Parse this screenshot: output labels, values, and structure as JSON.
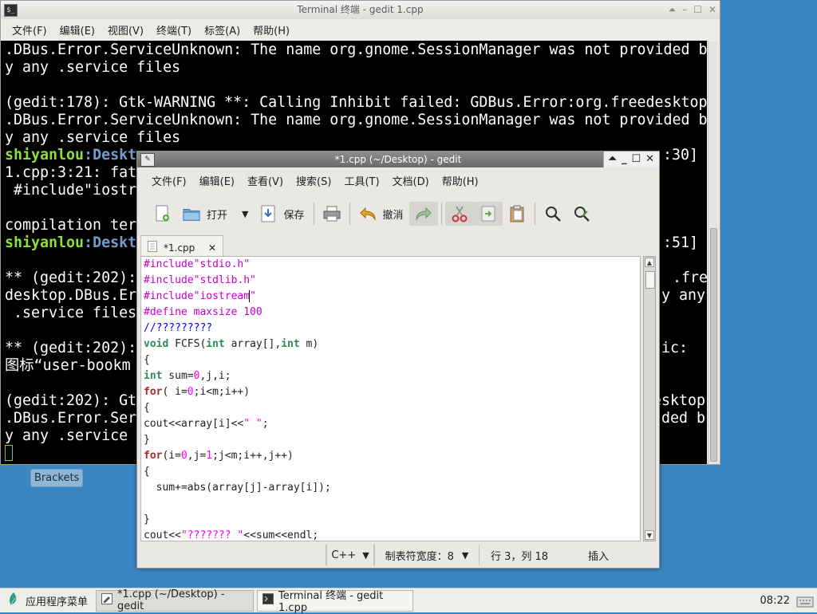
{
  "desktop": {
    "brackets_label": "Brackets"
  },
  "terminal": {
    "title": "Terminal 终端 - gedit 1.cpp",
    "menu": [
      "文件(F)",
      "编辑(E)",
      "视图(V)",
      "终端(T)",
      "标签(A)",
      "帮助(H)"
    ],
    "lines": [
      ".DBus.Error.ServiceUnknown: The name org.gnome.SessionManager was not provided b",
      "y any .service files",
      "",
      "(gedit:178): Gtk-WARNING **: Calling Inhibit failed: GDBus.Error:org.freedesktop",
      ".DBus.Error.ServiceUnknown: The name org.gnome.SessionManager was not provided b",
      "y any .service files",
      {
        "prompt_user": "shiyanlou",
        "prompt_path": ":Deskt",
        "tail": ":30]"
      },
      "1.cpp:3:21: fat",
      " #include\"iostr",
      "",
      "compilation ter",
      {
        "prompt_user": "shiyanlou",
        "prompt_path": ":Deskt",
        "tail": ":51]"
      },
      "",
      "** (gedit:202):",
      "desktop.DBus.Er",
      " .service files",
      "",
      "** (gedit:202):",
      "图标“user-bookm",
      "",
      "(gedit:202): Gt",
      ".DBus.Error.Ser",
      "y any .service"
    ],
    "right_fragments": [
      ".free",
      "y any",
      "ic:",
      "esktop",
      "ded b"
    ]
  },
  "gedit": {
    "title": "*1.cpp (~/Desktop) - gedit",
    "menu": [
      "文件(F)",
      "编辑(E)",
      "查看(V)",
      "搜索(S)",
      "工具(T)",
      "文档(D)",
      "帮助(H)"
    ],
    "toolbar": {
      "open": "打开",
      "save": "保存",
      "undo": "撤消"
    },
    "tab_label": "*1.cpp",
    "code": [
      "#include\"stdio.h\"",
      "#include\"stdlib.h\"",
      "#include\"iostream\"",
      "#define maxsize 100",
      "//?????????",
      "void FCFS(int array[],int m)",
      "{",
      "int sum=0,j,i;",
      "for( i=0;i<m;i++)",
      "{",
      "cout<<array[i]<<\" \";",
      "}",
      "for(i=0,j=1;j<m;i++,j++)",
      "{",
      "  sum+=abs(array[j]-array[i]);",
      "",
      "}",
      "cout<<\"??????? \"<<sum<<endl;"
    ],
    "status": {
      "lang": "C++",
      "tab_width": "制表符宽度：8",
      "position": "行 3，列 18",
      "mode": "插入"
    }
  },
  "taskbar": {
    "app_menu": "应用程序菜单",
    "tasks": [
      "*1.cpp (~/Desktop) - gedit",
      "Terminal 终端 - gedit 1.cpp"
    ],
    "clock": "08:22"
  }
}
